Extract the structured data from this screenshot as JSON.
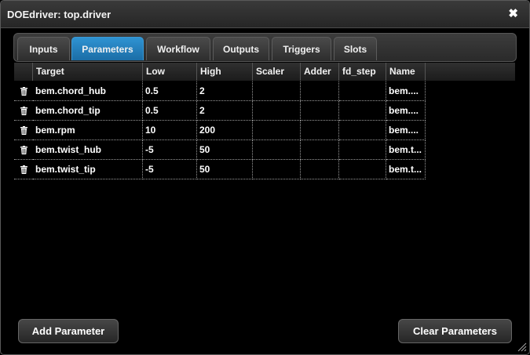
{
  "window": {
    "title": "DOEdriver: top.driver"
  },
  "tabs": [
    {
      "label": "Inputs",
      "active": false
    },
    {
      "label": "Parameters",
      "active": true
    },
    {
      "label": "Workflow",
      "active": false
    },
    {
      "label": "Outputs",
      "active": false
    },
    {
      "label": "Triggers",
      "active": false
    },
    {
      "label": "Slots",
      "active": false
    }
  ],
  "table": {
    "columns": [
      "",
      "Target",
      "Low",
      "High",
      "Scaler",
      "Adder",
      "fd_step",
      "Name"
    ],
    "rows": [
      [
        "bem.chord_hub",
        "0.5",
        "2",
        "",
        "",
        "",
        "bem...."
      ],
      [
        "bem.chord_tip",
        "0.5",
        "2",
        "",
        "",
        "",
        "bem...."
      ],
      [
        "bem.rpm",
        "10",
        "200",
        "",
        "",
        "",
        "bem...."
      ],
      [
        "bem.twist_hub",
        "-5",
        "50",
        "",
        "",
        "",
        "bem.t..."
      ],
      [
        "bem.twist_tip",
        "-5",
        "50",
        "",
        "",
        "",
        "bem.t..."
      ]
    ]
  },
  "buttons": {
    "add": "Add Parameter",
    "clear": "Clear Parameters"
  },
  "icons": {
    "delete": "trash-icon",
    "close": "close-icon",
    "resize": "resize-grip-icon"
  }
}
